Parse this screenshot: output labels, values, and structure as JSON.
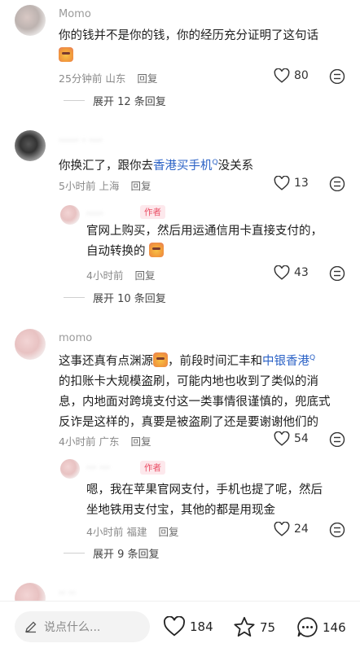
{
  "comments": [
    {
      "username": "Momo",
      "text": "你的钱并不是你的钱，你的经历充分证明了这句话",
      "time": "25分钟前",
      "location": "山东",
      "reply": "回复",
      "likes": "80",
      "expand": "展开 12 条回复"
    },
    {
      "username": "······ · ····",
      "text_before": "你换汇了，跟你去",
      "link": "香港买手机",
      "text_after": "没关系",
      "time": "5小时前",
      "location": "上海",
      "reply": "回复",
      "likes": "13",
      "sub_reply": {
        "username": "·····",
        "badge": "作者",
        "text_line1": "官网上购买，然后用运通信用卡直接支付的，",
        "text_line2": "自动转换的",
        "time": "4小时前",
        "reply": "回复",
        "likes": "43"
      },
      "expand": "展开 10 条回复"
    },
    {
      "username": "momo",
      "line1_before": "这事还真有点渊源",
      "line1_after": "，前段时间汇丰和",
      "link": "中银香港",
      "line2": "的扣账卡大规模盗刷，可能内地也收到了类似的消",
      "line3": "息，内地面对跨境支付这一类事情很谨慎的，兜底式",
      "line4": "反诈是这样的，真要是被盗刷了还是要谢谢他们的",
      "time": "4小时前",
      "location": "广东",
      "reply": "回复",
      "likes": "54",
      "sub_reply": {
        "username": "··· ···",
        "badge": "作者",
        "text_line1": "嗯，我在苹果官网支付，手机也提了呢，然后",
        "text_line2": "坐地铁用支付宝，其他的都是用现金",
        "time": "4小时前",
        "location": "福建",
        "reply": "回复",
        "likes": "24"
      },
      "expand": "展开 9 条回复"
    }
  ],
  "partial_username": "·· ··",
  "bottom_bar": {
    "placeholder": "说点什么...",
    "likes": "184",
    "favorites": "75",
    "comments": "146"
  },
  "colors": {
    "link": "#2b62c6",
    "author_badge": "#ea4f66"
  }
}
